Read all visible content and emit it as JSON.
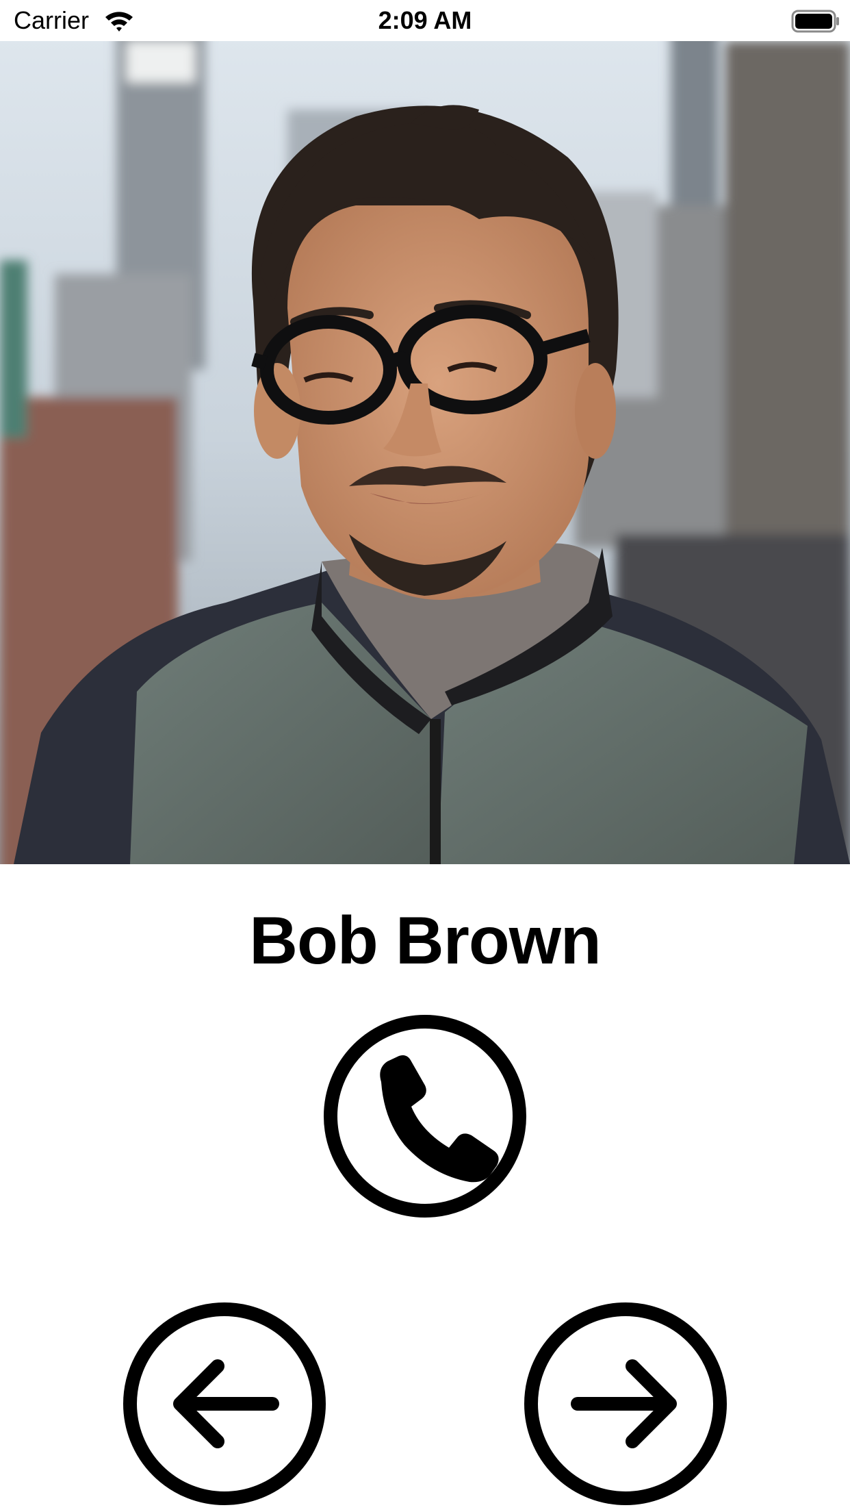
{
  "status_bar": {
    "carrier": "Carrier",
    "time": "2:09 AM",
    "wifi_icon": "wifi-icon",
    "battery_icon": "battery-icon"
  },
  "contact": {
    "name": "Bob Brown",
    "photo_icon": "contact-photo"
  },
  "actions": {
    "call_icon": "phone-icon",
    "previous_icon": "arrow-left-icon",
    "next_icon": "arrow-right-icon"
  }
}
